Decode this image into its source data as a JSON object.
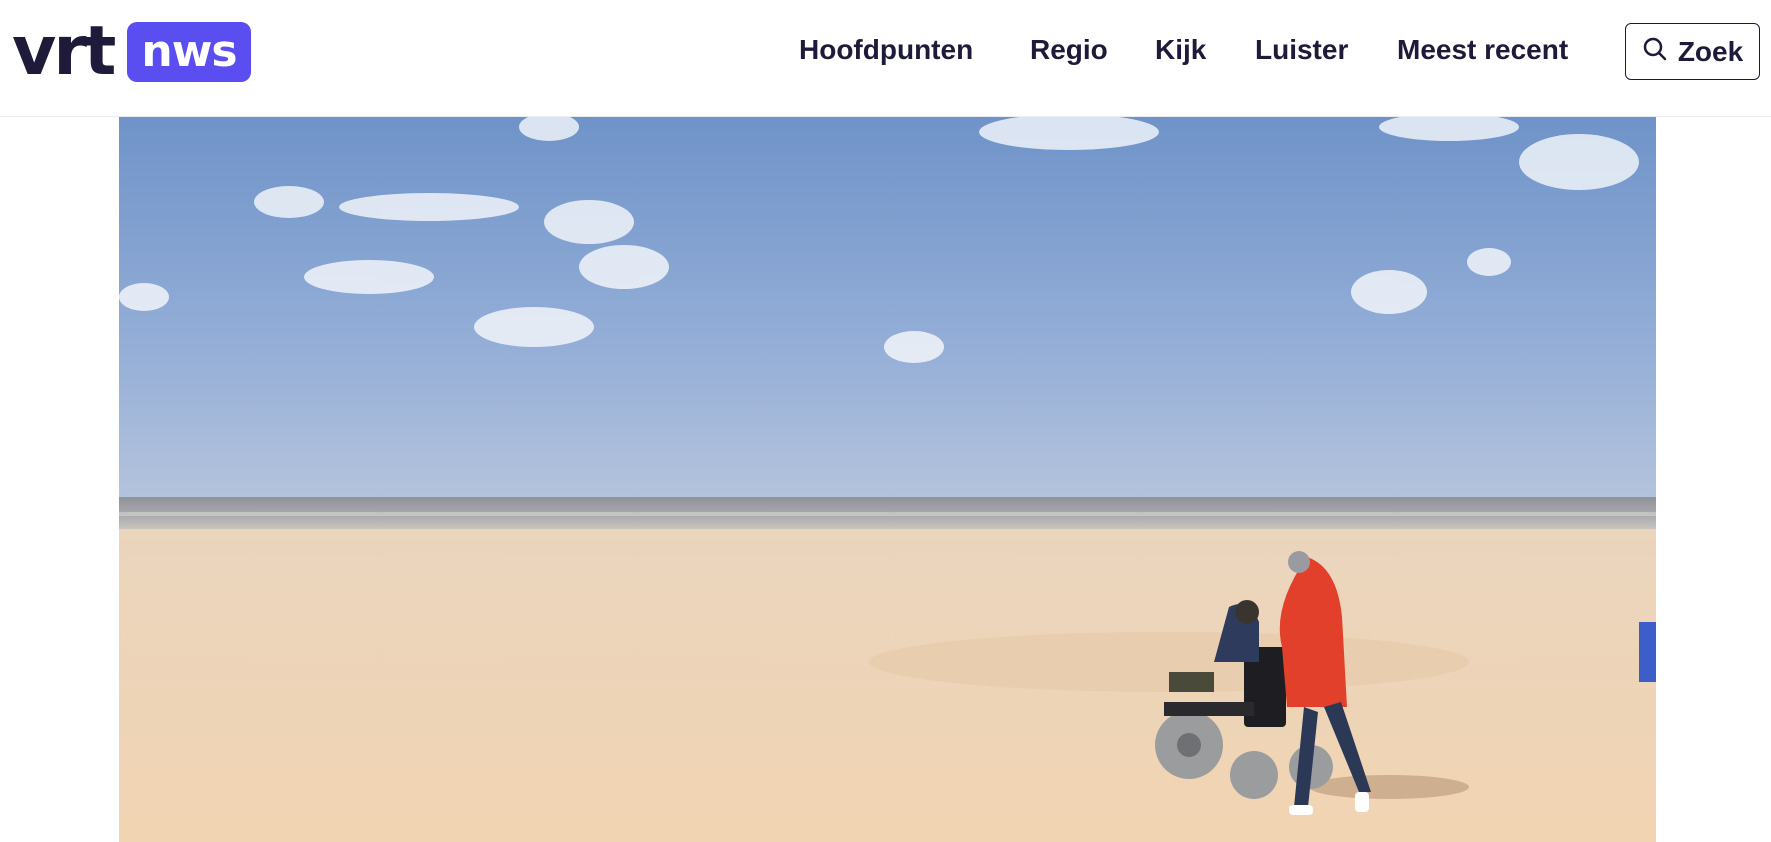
{
  "header": {
    "logo": {
      "left": "vrt",
      "right": "nws"
    },
    "nav": [
      {
        "label": "Hoofdpunten"
      },
      {
        "label": "Regio"
      },
      {
        "label": "Kijk"
      },
      {
        "label": "Luister"
      },
      {
        "label": "Meest recent"
      }
    ],
    "search": {
      "label": "Zoek",
      "icon": "search-icon"
    }
  },
  "hero": {
    "icon": "beach-photo"
  },
  "colors": {
    "brand": "#5b4ef0",
    "text": "#1e1b3a"
  }
}
